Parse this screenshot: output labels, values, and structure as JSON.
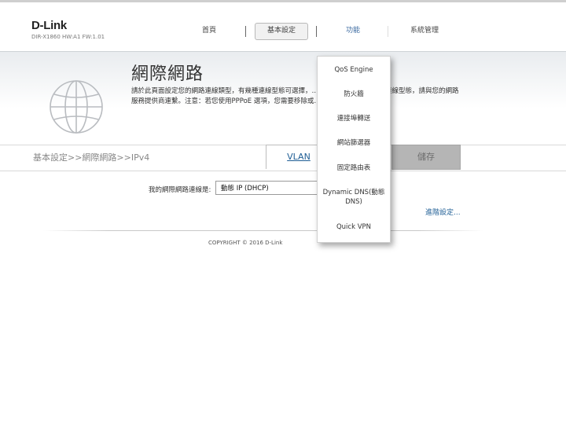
{
  "header": {
    "logo": "D-Link",
    "model": "DIR-X1860 HW:A1 FW:1.01",
    "nav": {
      "home": "首頁",
      "basic": "基本設定",
      "features": "功能",
      "system": "系統管理"
    }
  },
  "page": {
    "title": "網際網路",
    "description": "請於此頁面設定您的網路連線類型，有幾種連線型態可選擇，……，如果您不確定您的連線型態，請與您的網路服務提供商連繫。注意：若您使用PPPoE 選項，您需要移除或……PPPoE Client 軟體。"
  },
  "toolbar": {
    "breadcrumb": "基本設定>>網際網路>>IPv4",
    "vlan_label": "VLAN",
    "save_label": "儲存"
  },
  "form": {
    "connection_label": "我的網際網路連線是:",
    "connection_value": "動態 IP (DHCP)",
    "advanced_link": "進階設定..."
  },
  "footer": {
    "copyright": "COPYRIGHT © 2016 D-Link"
  },
  "dropdown": {
    "items": [
      {
        "label": "QoS Engine"
      },
      {
        "label": "防火牆"
      },
      {
        "label": "連接埠轉送"
      },
      {
        "label": "網站篩選器"
      },
      {
        "label": "固定路由表"
      },
      {
        "label": "Dynamic DNS(動態DNS)"
      },
      {
        "label": "Quick VPN"
      }
    ]
  },
  "colors": {
    "accent_link": "#1f5e95",
    "active_nav": "#3b6aa0",
    "save_button": "#b5b5b5"
  },
  "icons": {
    "globe": "globe-icon"
  }
}
